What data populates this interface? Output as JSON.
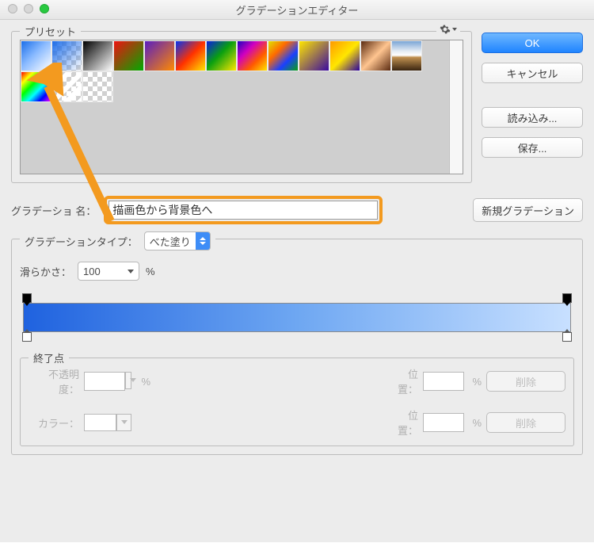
{
  "window": {
    "title": "グラデーションエディター"
  },
  "presets": {
    "legend": "プリセット"
  },
  "buttons": {
    "ok": "OK",
    "cancel": "キャンセル",
    "load": "読み込み...",
    "save": "保存...",
    "new_gradient": "新規グラデーション"
  },
  "name": {
    "label": "グラデーショ    名：",
    "value": "描画色から背景色へ"
  },
  "type": {
    "label": "グラデーションタイプ：",
    "value": "べた塗り"
  },
  "smooth": {
    "label": "滑らかさ：",
    "value": "100",
    "unit": "%"
  },
  "stops": {
    "legend": "終了点",
    "opacity_label": "不透明度：",
    "opacity_unit": "%",
    "color_label": "カラー：",
    "pos_label": "位置：",
    "pos_unit": "%",
    "delete": "削除"
  },
  "traffic": {
    "close": "#d7d7d7",
    "min": "#d7d7d7",
    "zoom": "#28c940"
  }
}
